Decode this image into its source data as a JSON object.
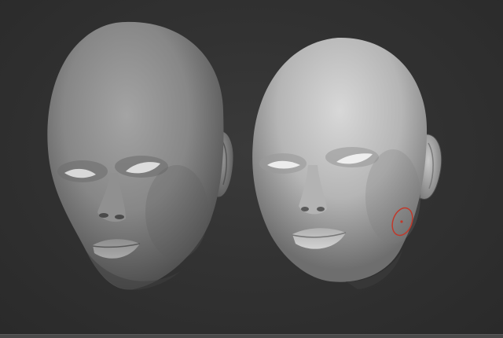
{
  "viewport": {
    "background": "#333333",
    "models": [
      {
        "id": "head-left",
        "material": "gray-clay"
      },
      {
        "id": "head-right",
        "material": "light-gray-clay"
      }
    ],
    "brush_cursor": {
      "color": "#c0392b",
      "visible": true
    }
  }
}
